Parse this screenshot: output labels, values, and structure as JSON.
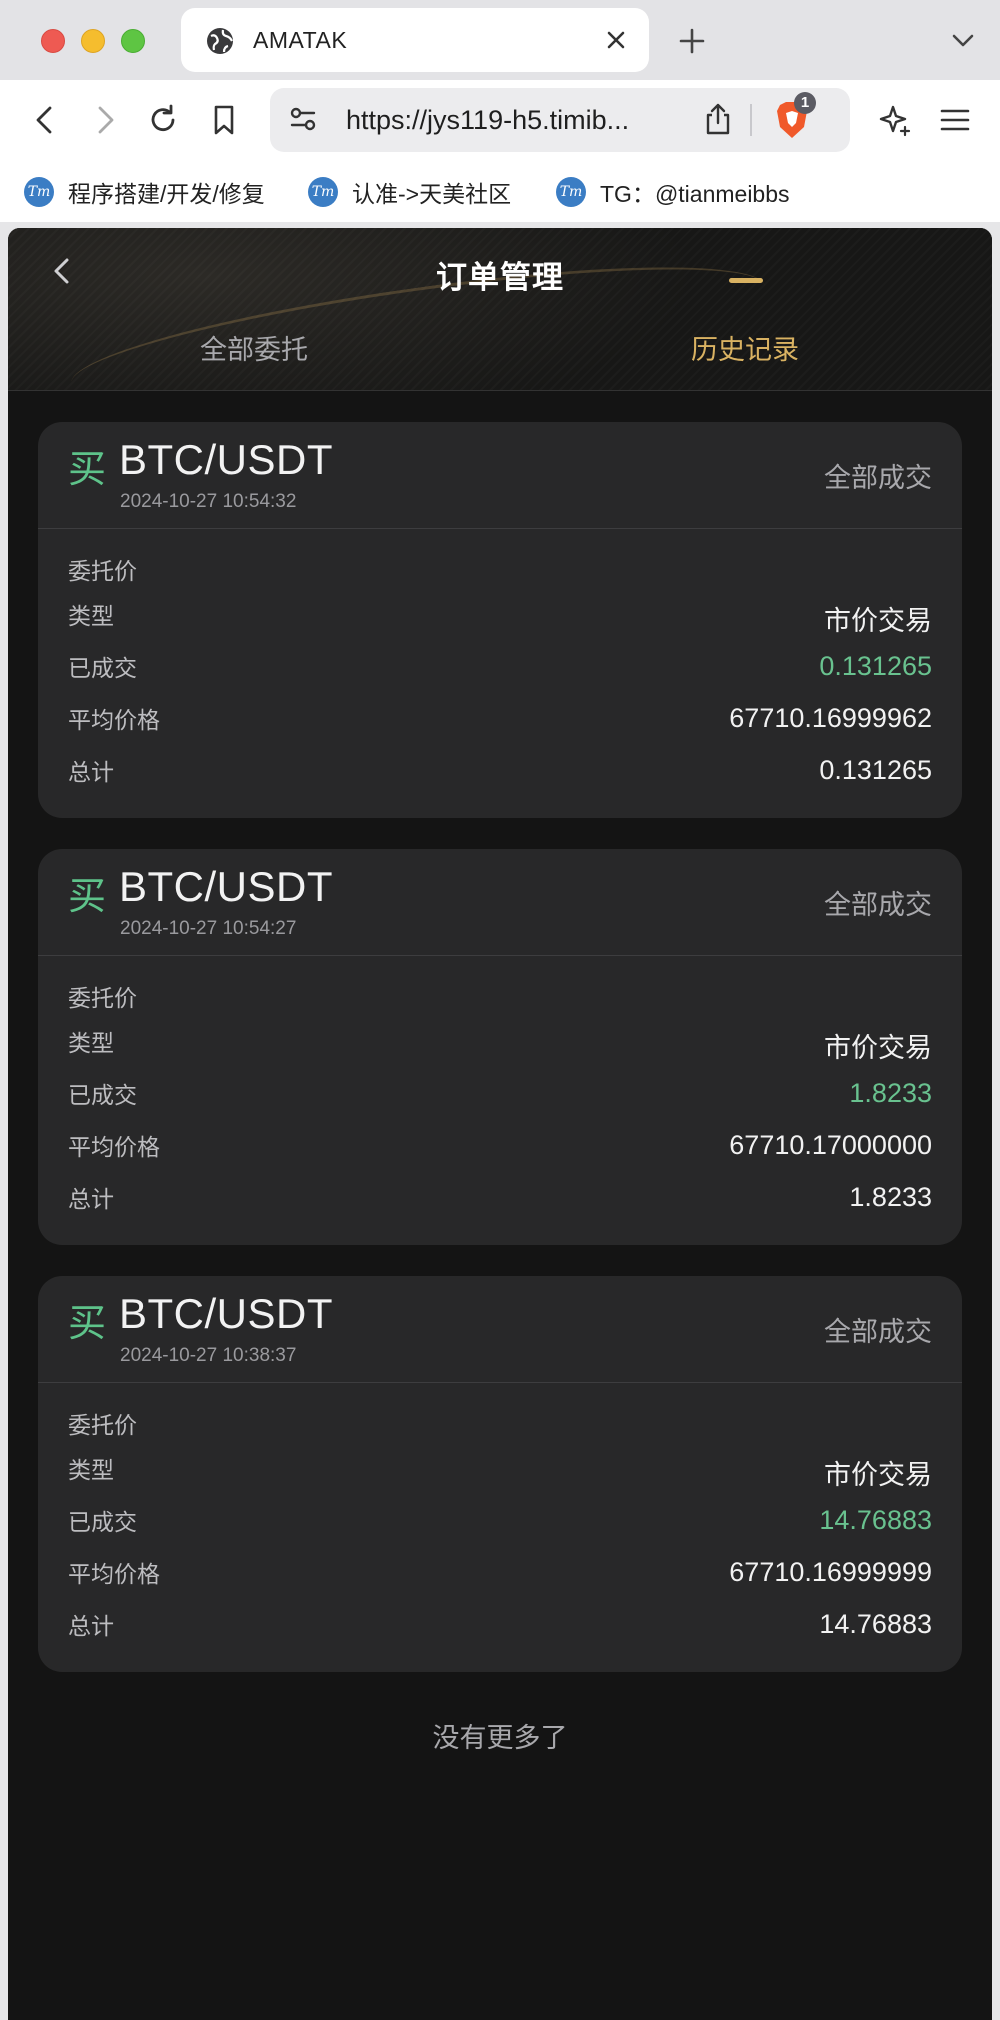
{
  "browser": {
    "tab_title": "AMATAK",
    "url": "https://jys119-h5.timib...",
    "shields_count": "1",
    "bookmarks": [
      {
        "label": "程序搭建/开发/修复"
      },
      {
        "label": "认准->天美社区"
      },
      {
        "label": "TG：@tianmeibbs"
      }
    ]
  },
  "app": {
    "title": "订单管理",
    "tabs": [
      {
        "label": "全部委托",
        "active": false
      },
      {
        "label": "历史记录",
        "active": true
      }
    ],
    "field_labels": {
      "price": "委托价",
      "type": "类型",
      "filled": "已成交",
      "avg_price": "平均价格",
      "total": "总计"
    },
    "orders": [
      {
        "side": "买",
        "pair": "BTC/USDT",
        "time": "2024-10-27 10:54:32",
        "status": "全部成交",
        "price": "",
        "type": "市价交易",
        "filled": "0.131265",
        "avg_price": "67710.16999962",
        "total": "0.131265"
      },
      {
        "side": "买",
        "pair": "BTC/USDT",
        "time": "2024-10-27 10:54:27",
        "status": "全部成交",
        "price": "",
        "type": "市价交易",
        "filled": "1.8233",
        "avg_price": "67710.17000000",
        "total": "1.8233"
      },
      {
        "side": "买",
        "pair": "BTC/USDT",
        "time": "2024-10-27 10:38:37",
        "status": "全部成交",
        "price": "",
        "type": "市价交易",
        "filled": "14.76883",
        "avg_price": "67710.16999999",
        "total": "14.76883"
      }
    ],
    "no_more": "没有更多了"
  },
  "colors": {
    "buy_green": "#5ec38a",
    "accent_gold": "#d9b262",
    "card_bg": "#282829",
    "page_bg": "#141414"
  }
}
